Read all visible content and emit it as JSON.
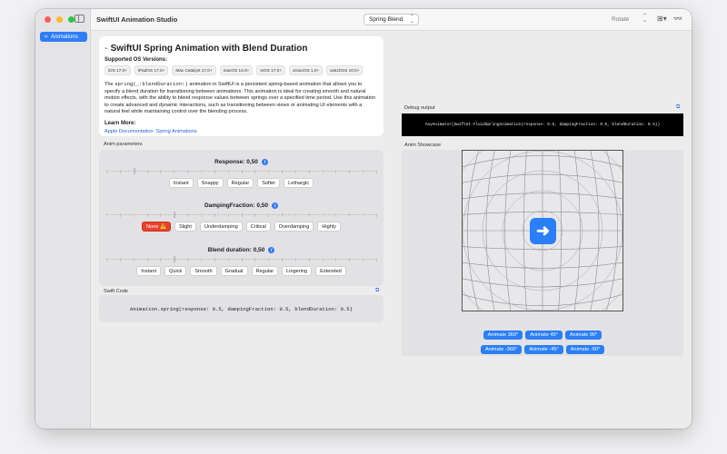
{
  "window": {
    "app_title": "SwiftUI Animation Studio"
  },
  "sidebar": {
    "items": [
      {
        "label": "Animations",
        "icon": "animation-icon"
      }
    ]
  },
  "toolbar": {
    "popup_value": "Spring Blend",
    "rotate_label": "Rotate"
  },
  "doc": {
    "title": "SwiftUI Spring Animation with Blend Duration",
    "supported_heading": "Supported OS Versions:",
    "versions": [
      "iOS 17.0+",
      "iPadOS 17.0+",
      "Mac Catalyst 17.0+",
      "macOS 14.0+",
      "tvOS 17.0+",
      "visionOS 1.0+",
      "watchOS 10.0+"
    ],
    "para_pre": "The",
    "para_code": "spring(_:blendDuration:)",
    "para_post": "animation in SwiftUI is a persistent spring-based animation that allows you to specify a blend duration for transitioning between animations. This animation is ideal for creating smooth and natural motion effects, with the ability to blend response values between springs over a specified time period. Use this animation to create advanced and dynamic interactions, such as transitioning between views or animating UI elements with a natural feel while maintaining control over the blending process.",
    "learn_more": "Learn More:",
    "link": "Apple Documentation: Spring Animations"
  },
  "params": {
    "section_label": "Anim parameters",
    "response": {
      "title": "Response: 0,50",
      "value": 0.5,
      "knob": 0.1,
      "buttons": [
        "Instant",
        "Snappy",
        "Regular",
        "Softer",
        "Lethargic"
      ]
    },
    "damping": {
      "title": "DampingFraction: 0,50",
      "value": 0.5,
      "knob": 0.25,
      "buttons": [
        "None ⚠️",
        "Slight",
        "Underdamping",
        "Critical",
        "Overdamping",
        "Highly"
      ]
    },
    "blend": {
      "title": "Blend duration: 0,50",
      "value": 0.5,
      "knob": 0.25,
      "buttons": [
        "Instant",
        "Quick",
        "Smooth",
        "Gradual",
        "Regular",
        "Lingering",
        "Extended"
      ]
    }
  },
  "swift_code": {
    "label": "Swift Code",
    "code": "Animation.spring(response: 0.5, dampingFraction: 0.5, blendDuration: 0.5)"
  },
  "debug": {
    "label": "Debug output",
    "text": "AnyAnimator(SwiftUI.FluidSpringAnimation(response: 0.5, dampingFraction: 0.5, blendDuration: 0.5))"
  },
  "showcase": {
    "label": "Anim Showcase",
    "row1": [
      "Animate 360°",
      "Animate 45°",
      "Animate 90°"
    ],
    "row2": [
      "Animate -360°",
      "Animate -45°",
      "Animate -90°"
    ]
  },
  "colors": {
    "accent": "#2a7ff7",
    "danger": "#e8422d"
  }
}
